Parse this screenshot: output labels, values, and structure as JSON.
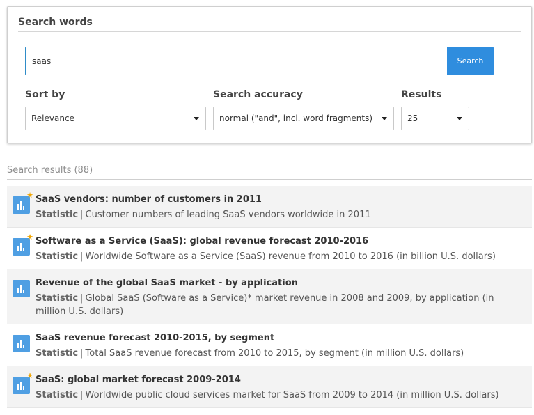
{
  "search": {
    "heading": "Search words",
    "query": "saas",
    "button_label": "Search"
  },
  "filters": {
    "sort_by": {
      "label": "Sort by",
      "value": "Relevance"
    },
    "accuracy": {
      "label": "Search accuracy",
      "value": "normal (\"and\", incl. word fragments)"
    },
    "results": {
      "label": "Results",
      "value": "25"
    }
  },
  "results_header": "Search results (88)",
  "results": [
    {
      "title": "SaaS vendors: number of customers in 2011",
      "type": "Statistic",
      "separator": "|",
      "description": "Customer numbers of leading SaaS vendors worldwide in 2011",
      "premium": true
    },
    {
      "title": "Software as a Service (SaaS): global revenue forecast 2010-2016",
      "type": "Statistic",
      "separator": "|",
      "description": "Worldwide Software as a Service (SaaS) revenue from 2010 to 2016 (in billion U.S. dollars)",
      "premium": true
    },
    {
      "title": "Revenue of the global SaaS market - by application",
      "type": "Statistic",
      "separator": "|",
      "description": "Global SaaS (Software as a Service)* market revenue in 2008 and 2009, by application (in million U.S. dollars)",
      "premium": false
    },
    {
      "title": "SaaS revenue forecast 2010-2015, by segment",
      "type": "Statistic",
      "separator": "|",
      "description": "Total SaaS revenue forecast from 2010 to 2015, by segment (in million U.S. dollars)",
      "premium": false
    },
    {
      "title": "SaaS: global market forecast 2009-2014",
      "type": "Statistic",
      "separator": "|",
      "description": "Worldwide public cloud services market for SaaS from 2009 to 2014 (in million U.S. dollars)",
      "premium": true
    }
  ],
  "icons": {
    "result_icon": "bar-chart-icon",
    "premium_badge": "star-icon",
    "dropdown": "caret-down-icon"
  },
  "colors": {
    "accent": "#2f8dde",
    "icon_blue": "#4f9fe3",
    "premium_star": "#f0a500"
  }
}
